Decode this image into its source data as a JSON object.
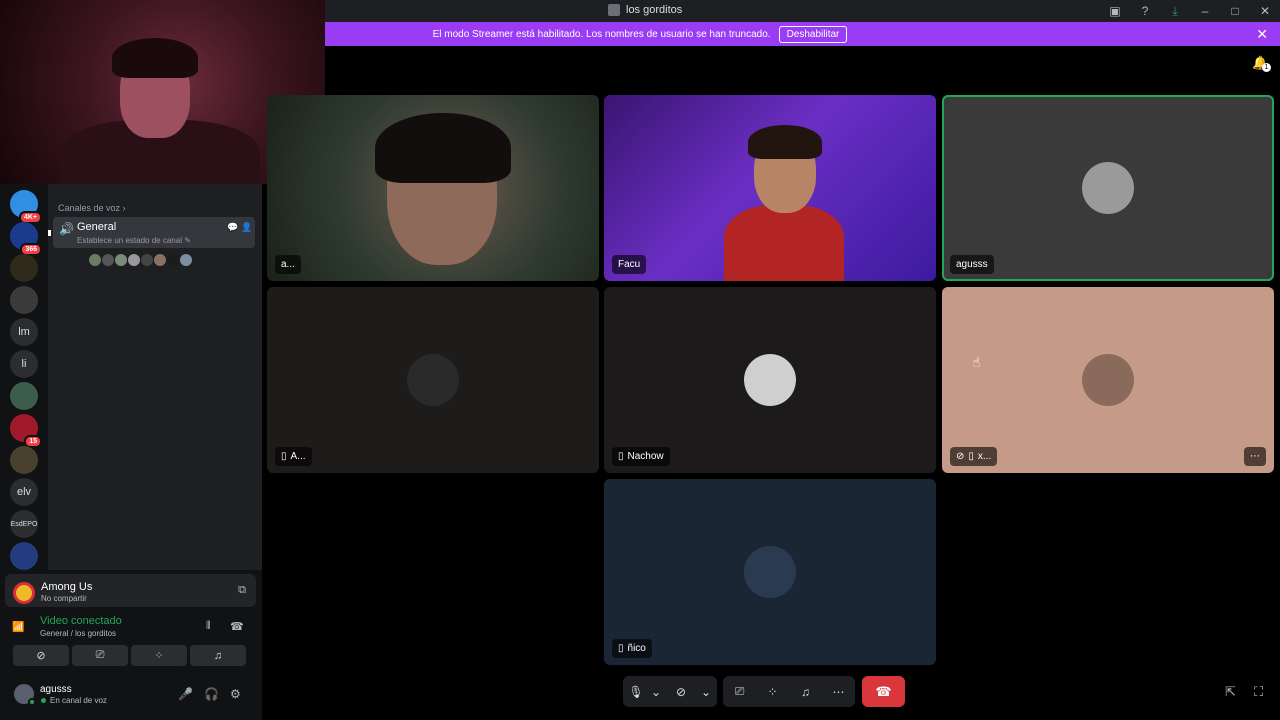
{
  "window": {
    "title": "los gorditos"
  },
  "banner": {
    "text": "El modo Streamer está habilitado. Los nombres de usuario se han truncado.",
    "button": "Deshabilitar"
  },
  "servers": [
    {
      "label": "",
      "badge": "4K+",
      "color": "#2f8fe3"
    },
    {
      "label": "",
      "badge": "366",
      "color": "#1b3a8c"
    },
    {
      "label": "",
      "badge": "",
      "color": "#2f2a1c"
    },
    {
      "label": "",
      "badge": "",
      "color": "#3a3a3a"
    },
    {
      "label": "lm",
      "badge": ""
    },
    {
      "label": "li",
      "badge": ""
    },
    {
      "label": "",
      "badge": "",
      "color": "#3d5d4b"
    },
    {
      "label": "",
      "badge": "15",
      "color": "#a11a2c"
    },
    {
      "label": "",
      "badge": "",
      "color": "#4a4030"
    },
    {
      "label": "elv",
      "badge": ""
    },
    {
      "label": "EsdEPO",
      "badge": ""
    },
    {
      "label": "",
      "badge": "",
      "color": "#233c80"
    }
  ],
  "sidebar": {
    "category": "Canales de voz",
    "channel": {
      "name": "General",
      "status_prompt": "Establece un estado de canal"
    },
    "avatar_colors": [
      "#6b7d62",
      "#555",
      "#7a8b7a",
      "#999",
      "#444",
      "#8a7060",
      "#1c1c1c",
      "#7d8fa0"
    ]
  },
  "activity": {
    "title": "Among Us",
    "subtitle": "No compartir"
  },
  "voice": {
    "status": "Video conectado",
    "location": "General / los gorditos"
  },
  "user": {
    "name": "agusss",
    "status": "En canal de voz"
  },
  "tiles": [
    {
      "name": "a...",
      "mobile": false,
      "speaking": true
    },
    {
      "name": "Facu",
      "mobile": false,
      "speaking": false
    },
    {
      "name": "agusss",
      "mobile": false,
      "speaking": true
    },
    {
      "name": "A...",
      "mobile": true,
      "speaking": false
    },
    {
      "name": "Nachow",
      "mobile": true,
      "speaking": false
    },
    {
      "name": "x...",
      "mobile": true,
      "speaking": false,
      "muted_video": true
    },
    {
      "name": "ñico",
      "mobile": true,
      "speaking": false
    }
  ],
  "inbox_badge": "1",
  "colors": {
    "accent": "#9b3cf5",
    "online": "#23a55a",
    "danger": "#da373c"
  }
}
